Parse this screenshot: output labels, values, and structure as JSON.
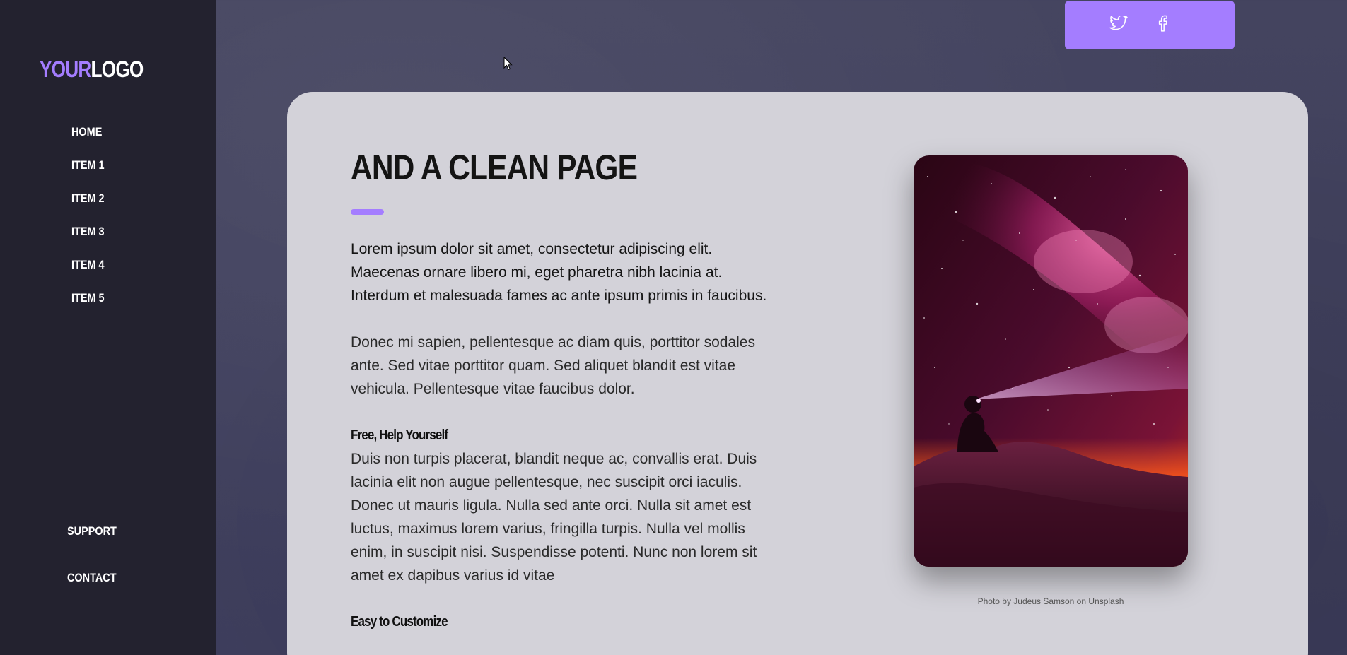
{
  "logo": {
    "part1": "YOUR",
    "part2": "LOGO"
  },
  "nav": {
    "items": [
      {
        "label": "HOME"
      },
      {
        "label": "ITEM 1"
      },
      {
        "label": "ITEM 2"
      },
      {
        "label": "ITEM 3"
      },
      {
        "label": "ITEM 4"
      },
      {
        "label": "ITEM 5"
      }
    ],
    "bottom": [
      {
        "label": "SUPPORT"
      },
      {
        "label": "CONTACT"
      }
    ]
  },
  "social": {
    "icons": [
      "twitter-icon",
      "facebook-icon"
    ]
  },
  "main": {
    "title": "AND A CLEAN PAGE",
    "lead": "Lorem ipsum dolor sit amet, consectetur adipiscing elit. Maecenas ornare libero mi, eget pharetra nibh lacinia at. Interdum et malesuada fames ac ante ipsum primis in faucibus.",
    "paragraph1": "Donec mi sapien, pellentesque ac diam quis, porttitor sodales ante. Sed vitae porttitor quam. Sed aliquet blandit est vitae vehicula. Pellentesque vitae faucibus dolor.",
    "section1": {
      "heading": "Free, Help Yourself",
      "text": "Duis non turpis placerat, blandit neque ac, convallis erat. Duis lacinia elit non augue pellentesque, nec suscipit orci iaculis. Donec ut mauris ligula. Nulla sed ante orci. Nulla sit amet est luctus, maximus lorem varius, fringilla turpis. Nulla vel mollis enim, in suscipit nisi. Suspendisse potenti. Nunc non lorem sit amet ex dapibus varius id vitae"
    },
    "section2": {
      "heading": "Easy to Customize"
    },
    "photo_caption": "Photo by Judeus Samson on Unsplash"
  },
  "colors": {
    "accent": "#a47dff",
    "sidebar": "#23222f",
    "background": "#3d3d5c",
    "card": "#d3d2d9"
  }
}
